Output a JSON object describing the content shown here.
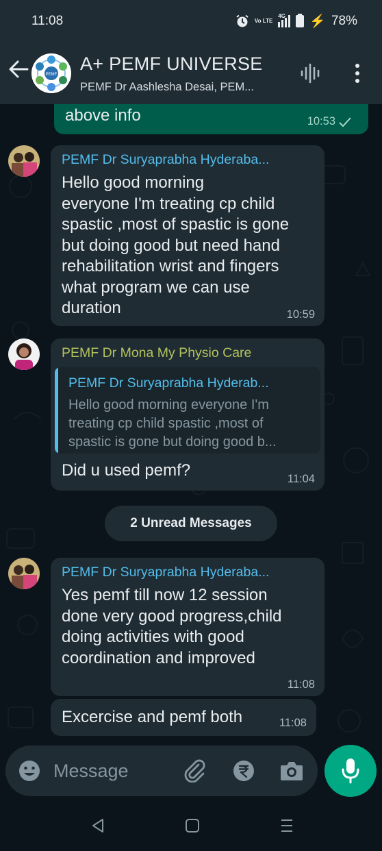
{
  "status_bar": {
    "time": "11:08",
    "network_label": "4G",
    "volte_label": "Vo LTE",
    "battery": "78%"
  },
  "header": {
    "title": "A+ PEMF UNIVERSE",
    "subtitle": "PEMF Dr Aashlesha Desai, PEM...",
    "avatar_text": "PEMF"
  },
  "messages": {
    "m0": {
      "text": "above info",
      "time": "10:53",
      "status_icon": "double-check-icon"
    },
    "m1": {
      "sender": "PEMF Dr  Suryaprabha  Hyderaba...",
      "sender_color": "#53bdeb",
      "text": "Hello good morning\neveryone I'm treating cp child\nspastic ,most of spastic is gone\nbut doing good but need hand\nrehabilitation wrist and fingers\nwhat program we can use\nduration",
      "time": "10:59"
    },
    "m2": {
      "sender": "PEMF Dr Mona My Physio Care",
      "sender_color": "#b4c25b",
      "quote_sender": "PEMF Dr  Suryaprabha  Hyderab...",
      "quote_text": "Hello good morning everyone I'm\ntreating cp child spastic ,most of\nspastic is gone but doing good b...",
      "text": "Did u used pemf?",
      "time": "11:04"
    },
    "unread_label": "2 Unread Messages",
    "m3": {
      "sender": "PEMF Dr  Suryaprabha  Hyderaba...",
      "sender_color": "#53bdeb",
      "text": "Yes pemf till now 12 session\ndone very good progress,child\ndoing activities with good\ncoordination and improved",
      "time": "11:08"
    },
    "m4": {
      "text": "Excercise and pemf both",
      "time": "11:08"
    }
  },
  "input": {
    "placeholder": "Message",
    "icons": [
      "emoji-icon",
      "attach-icon",
      "rupee-icon",
      "camera-icon",
      "mic-icon"
    ]
  },
  "colors": {
    "background": "#0b141a",
    "header": "#1f2c34",
    "incoming_bubble": "#1f2c34",
    "outgoing_bubble": "#005c4b",
    "accent": "#00a884"
  }
}
